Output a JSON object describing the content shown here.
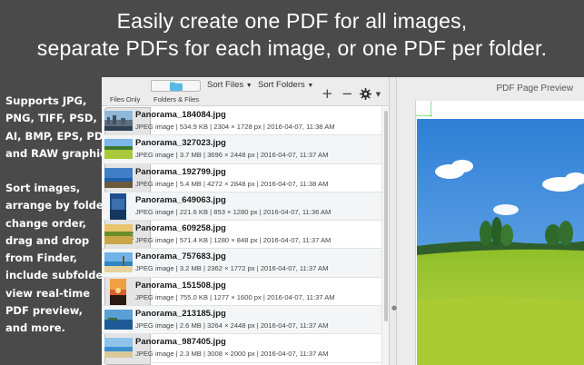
{
  "headline": {
    "line1": "Easily create one PDF for all images,",
    "line2": "separate PDFs for each image, or one PDF per folder."
  },
  "features": {
    "formats": [
      "Supports JPG,",
      "PNG, TIFF, PSD,",
      "AI, BMP, EPS, PDF,",
      "and RAW graphics."
    ],
    "capabilities": [
      "Sort images,",
      "arrange by folders,",
      "change order,",
      "drag and drop",
      "from Finder,",
      "include subfolders,",
      "view real-time",
      "PDF preview,",
      "and more."
    ]
  },
  "toolbar": {
    "files_only": "Files Only",
    "folders_files": "Folders & Files",
    "sort_files": "Sort Files",
    "sort_folders": "Sort Folders",
    "add": "+",
    "remove": "−"
  },
  "preview": {
    "title": "PDF Page Preview"
  },
  "files": [
    {
      "name": "Panorama_184084.jpg",
      "meta": "JPEG image | 534.9 KB | 2304 × 1728 px | 2016-04-07, 11:38 AM",
      "thumb": "city"
    },
    {
      "name": "Panorama_327023.jpg",
      "meta": "JPEG image | 3.7 MB | 3696 × 2448 px | 2016-04-07, 11:37 AM",
      "thumb": "meadow"
    },
    {
      "name": "Panorama_192799.jpg",
      "meta": "JPEG image | 5.4 MB | 4272 × 2848 px | 2016-04-07, 11:38 AM",
      "thumb": "coast"
    },
    {
      "name": "Panorama_649063.jpg",
      "meta": "JPEG image | 221.6 KB | 853 × 1280 px | 2016-04-07, 11:36 AM",
      "thumb": "tall"
    },
    {
      "name": "Panorama_609258.jpg",
      "meta": "JPEG image | 571.4 KB | 1280 × 848 px | 2016-04-07, 11:37 AM",
      "thumb": "field"
    },
    {
      "name": "Panorama_757683.jpg",
      "meta": "JPEG image | 3.2 MB | 2362 × 1772 px | 2016-04-07, 11:37 AM",
      "thumb": "beach"
    },
    {
      "name": "Panorama_151508.jpg",
      "meta": "JPEG image | 755.0 KB | 1277 × 1600 px | 2016-04-07, 11:37 AM",
      "thumb": "sunset"
    },
    {
      "name": "Panorama_213185.jpg",
      "meta": "JPEG image | 2.6 MB | 3264 × 2448 px | 2016-04-07, 11:37 AM",
      "thumb": "sea"
    },
    {
      "name": "Panorama_987405.jpg",
      "meta": "JPEG image | 2.3 MB | 3008 × 2000 px | 2016-04-07, 11:37 AM",
      "thumb": "shore"
    }
  ],
  "colors": {
    "background": "#4a4a4a",
    "folder_icon": "#58b8e8",
    "crop_mark": "#8fe08f"
  }
}
